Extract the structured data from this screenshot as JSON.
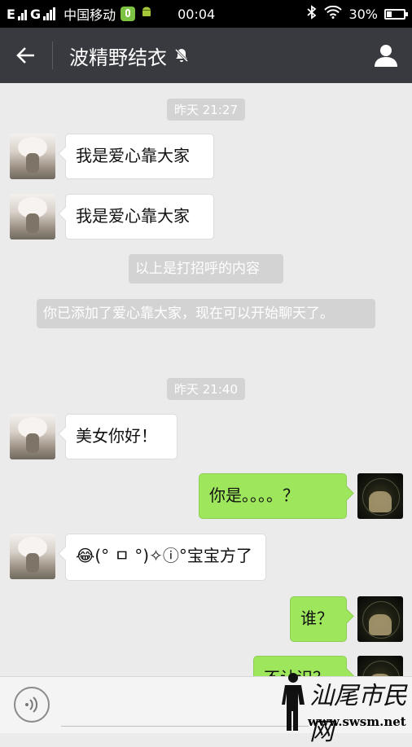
{
  "status_bar": {
    "network_1": "E",
    "network_2": "G",
    "carrier": "中国移动",
    "time": "00:04",
    "battery_percent": "30%",
    "battery_level": 0.3
  },
  "header": {
    "title": "波精野结衣"
  },
  "messages": [
    {
      "type": "time",
      "text": "昨天 21:27"
    },
    {
      "type": "left",
      "text": "我是爱心靠大家"
    },
    {
      "type": "left",
      "text": "我是爱心靠大家"
    },
    {
      "type": "system",
      "text": "以上是打招呼的内容"
    },
    {
      "type": "system",
      "text": "你已添加了爱心靠大家，现在可以开始聊天了。"
    },
    {
      "type": "time",
      "text": "昨天 21:40"
    },
    {
      "type": "left",
      "text": "美女你好！"
    },
    {
      "type": "right",
      "text": "你是。。。。？"
    },
    {
      "type": "left",
      "text": "😂(° ㅁ °)✧ⓘ°宝宝方了"
    },
    {
      "type": "right",
      "text": "谁？"
    },
    {
      "type": "right",
      "text": "不认识？"
    }
  ],
  "watermark": {
    "brand": "汕尾市民网",
    "url": "www.swsm.net"
  },
  "colors": {
    "header_bg": "#393a3f",
    "chat_bg": "#ebebeb",
    "bubble_sent": "#9ee75c",
    "bubble_received": "#ffffff"
  }
}
